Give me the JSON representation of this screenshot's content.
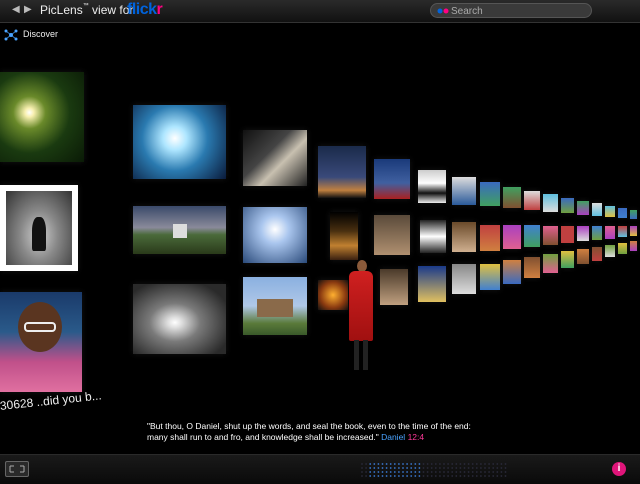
{
  "header": {
    "brand": "PicLens",
    "brand_tm": "™",
    "brand_suffix": "view for",
    "flickr_a": "flick",
    "flickr_b": "r",
    "search_placeholder": "Search"
  },
  "nav": {
    "back_glyph": "◀",
    "forward_glyph": "▶"
  },
  "discover": {
    "label": "Discover"
  },
  "gallery": {
    "overlay_title": "30628 ..did you b..."
  },
  "caption": {
    "quote_line1": "\"But thou, O Daniel, shut up the words, and seal the book, even to the time of the end:",
    "quote_line2": "many shall run to and fro, and knowledge shall be increased.\"",
    "ref_book": "Daniel",
    "ref_verse": "12:4"
  },
  "footer": {
    "info_glyph": "i"
  },
  "colors": {
    "flickr_blue": "#0063dc",
    "flickr_pink": "#ff0084",
    "accent_blue": "#4aa3ff",
    "info_pink": "#e0157a"
  }
}
